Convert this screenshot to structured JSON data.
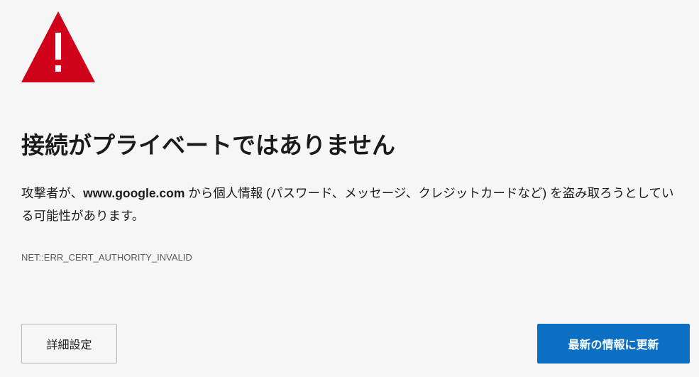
{
  "icons": {
    "warning": "warning-triangle-icon",
    "warning_color": "#d0021b"
  },
  "heading": "接続がプライベートではありません",
  "description": {
    "before": "攻撃者が、",
    "host": "www.google.com",
    "after": " から個人情報 (パスワード、メッセージ、クレジットカードなど) を盗み取ろうとしている可能性があります。"
  },
  "error_code": "NET::ERR_CERT_AUTHORITY_INVALID",
  "buttons": {
    "advanced": "詳細設定",
    "refresh": "最新の情報に更新",
    "refresh_color": "#0b6fc4"
  }
}
